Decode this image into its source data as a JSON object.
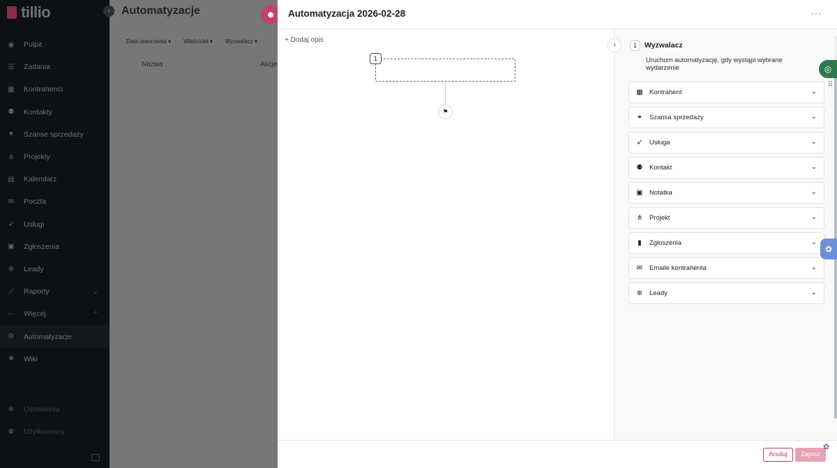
{
  "app": {
    "logo_text": "tillio"
  },
  "sidebar": {
    "items": [
      {
        "label": "Pulpit",
        "icon": "dashboard-icon"
      },
      {
        "label": "Zadania",
        "icon": "tasks-icon"
      },
      {
        "label": "Kontrahenci",
        "icon": "building-icon"
      },
      {
        "label": "Kontakty",
        "icon": "contacts-icon"
      },
      {
        "label": "Szanse sprzedaży",
        "icon": "funnel-icon"
      },
      {
        "label": "Projekty",
        "icon": "project-icon"
      },
      {
        "label": "Kalendarz",
        "icon": "calendar-icon"
      },
      {
        "label": "Poczta",
        "icon": "mail-icon"
      },
      {
        "label": "Usługi",
        "icon": "rocket-icon"
      },
      {
        "label": "Zgłoszenia",
        "icon": "clipboard-icon"
      },
      {
        "label": "Leady",
        "icon": "target-icon"
      },
      {
        "label": "Raporty",
        "icon": "chart-icon"
      },
      {
        "label": "Więcej",
        "icon": "dots-icon"
      },
      {
        "label": "Automatyzacje",
        "icon": "robot-icon"
      },
      {
        "label": "Wiki",
        "icon": "wiki-icon"
      }
    ],
    "bottom": [
      {
        "label": "Ustawienia",
        "icon": "gear-icon"
      },
      {
        "label": "Użytkownicy",
        "icon": "users-icon"
      }
    ]
  },
  "main": {
    "title": "Automatyzacje",
    "filters": [
      "Data utworzenia ▾",
      "Właściciel ▾",
      "Wyzwalacz ▾"
    ],
    "columns": [
      "Nazwa",
      "Akcje"
    ]
  },
  "drawer": {
    "title": "Automatyzacja 2026-02-28",
    "more": "···",
    "add_description": "+ Dodaj opis",
    "step_number": "1",
    "trigger": {
      "number": "1",
      "title": "Wyzwalacz",
      "description": "Uruchom automatyzację, gdy wystąpi wybrane wydarzenie"
    },
    "sections": [
      {
        "label": "Kontrahent",
        "icon": "building-icon"
      },
      {
        "label": "Szansa sprzedaży",
        "icon": "handshake-icon"
      },
      {
        "label": "Usługa",
        "icon": "rocket-icon"
      },
      {
        "label": "Kontakt",
        "icon": "contacts-icon"
      },
      {
        "label": "Notatka",
        "icon": "note-icon"
      },
      {
        "label": "Projekt",
        "icon": "project-icon"
      },
      {
        "label": "Zgłoszenia",
        "icon": "clipboard-icon"
      },
      {
        "label": "Emaile kontrahenta",
        "icon": "mail-icon"
      },
      {
        "label": "Leady",
        "icon": "target-icon"
      }
    ],
    "footer": {
      "cancel": "Anuluj",
      "save": "Zapisz"
    }
  }
}
